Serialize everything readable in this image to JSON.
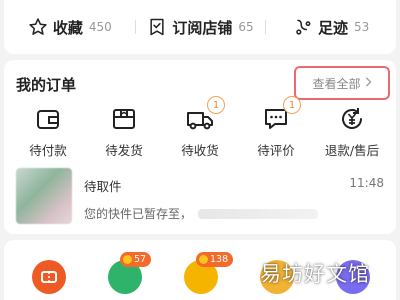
{
  "stats": [
    {
      "label": "收藏",
      "count": "450",
      "icon": "star-icon"
    },
    {
      "label": "订阅店铺",
      "count": "65",
      "icon": "bookmark-store-icon"
    },
    {
      "label": "足迹",
      "count": "53",
      "icon": "footprint-icon"
    }
  ],
  "orders": {
    "title": "我的订单",
    "view_all": "查看全部",
    "items": [
      {
        "label": "待付款",
        "icon": "wallet-icon",
        "badge": ""
      },
      {
        "label": "待发货",
        "icon": "package-icon",
        "badge": ""
      },
      {
        "label": "待收货",
        "icon": "truck-icon",
        "badge": "1"
      },
      {
        "label": "待评价",
        "icon": "comment-icon",
        "badge": "1"
      },
      {
        "label": "退款/售后",
        "icon": "refund-icon",
        "badge": ""
      }
    ]
  },
  "parcel": {
    "title": "待取件",
    "description": "您的快件已暂存至，",
    "time": "11:48"
  },
  "apps": [
    {
      "name": "ticket-app-icon",
      "color": "#ee5a24",
      "badge": ""
    },
    {
      "name": "green-app-icon",
      "color": "#2fb36b",
      "badge": "57"
    },
    {
      "name": "coin-app-icon",
      "color": "#f5b400",
      "badge": "138"
    },
    {
      "name": "face-app-icon",
      "color": "#f2b233",
      "badge": ""
    },
    {
      "name": "colorful-app-icon",
      "color": "#7a6cf0",
      "badge": ""
    }
  ],
  "colors": {
    "accent": "#f36a2b",
    "highlight_border": "#e96a72",
    "badge_ring": "#f0a35a"
  },
  "watermark": "易坊好文馆"
}
